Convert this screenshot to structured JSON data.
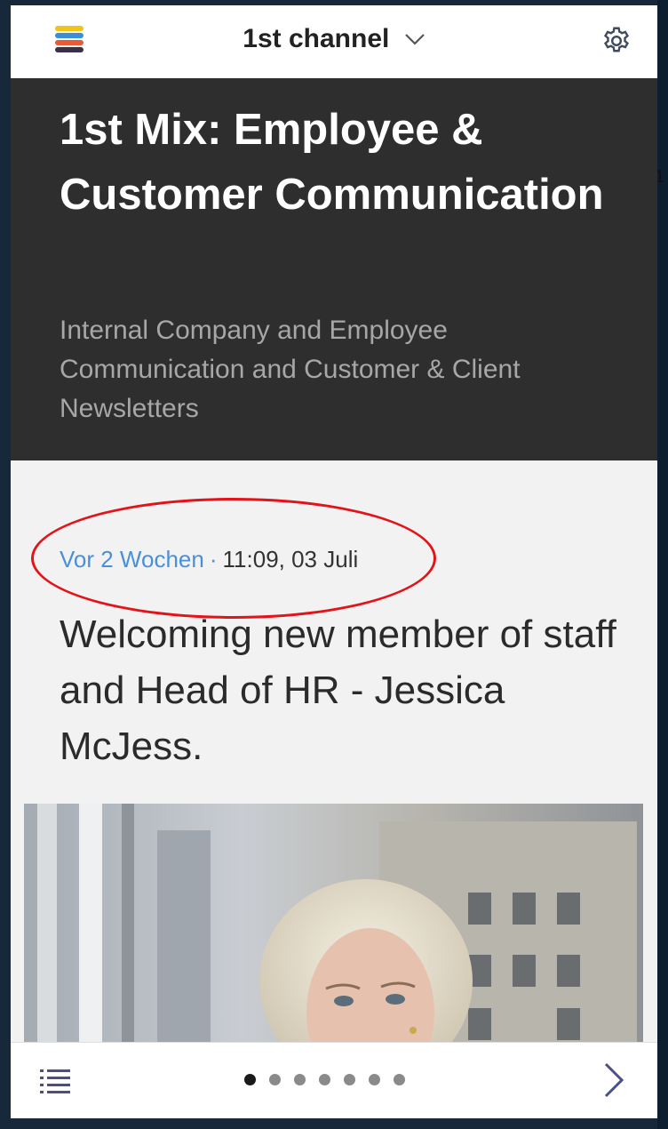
{
  "header": {
    "channel_title": "1st channel",
    "icons": {
      "menu": "stacked-layers-logo-icon",
      "dropdown": "chevron-down-icon",
      "settings": "gear-icon"
    }
  },
  "hero": {
    "title": "1st Mix: Employee & Customer Communication",
    "subtitle": "Internal Company and Employee Communication and Customer & Client Newsletters"
  },
  "article": {
    "relative_time": "Vor 2 Wochen",
    "separator": "·",
    "timestamp": "11:09, 03 Juli",
    "title": "Welcoming new member of staff and Head of HR - Jessica McJess."
  },
  "footer": {
    "page_count": 7,
    "active_page": 1,
    "icons": {
      "list": "list-icon",
      "next": "chevron-right-icon"
    }
  },
  "edge_text": "1",
  "colors": {
    "accent": "#4a90d9",
    "hero_bg": "#2e2e2e",
    "annotation": "#e3131a"
  }
}
